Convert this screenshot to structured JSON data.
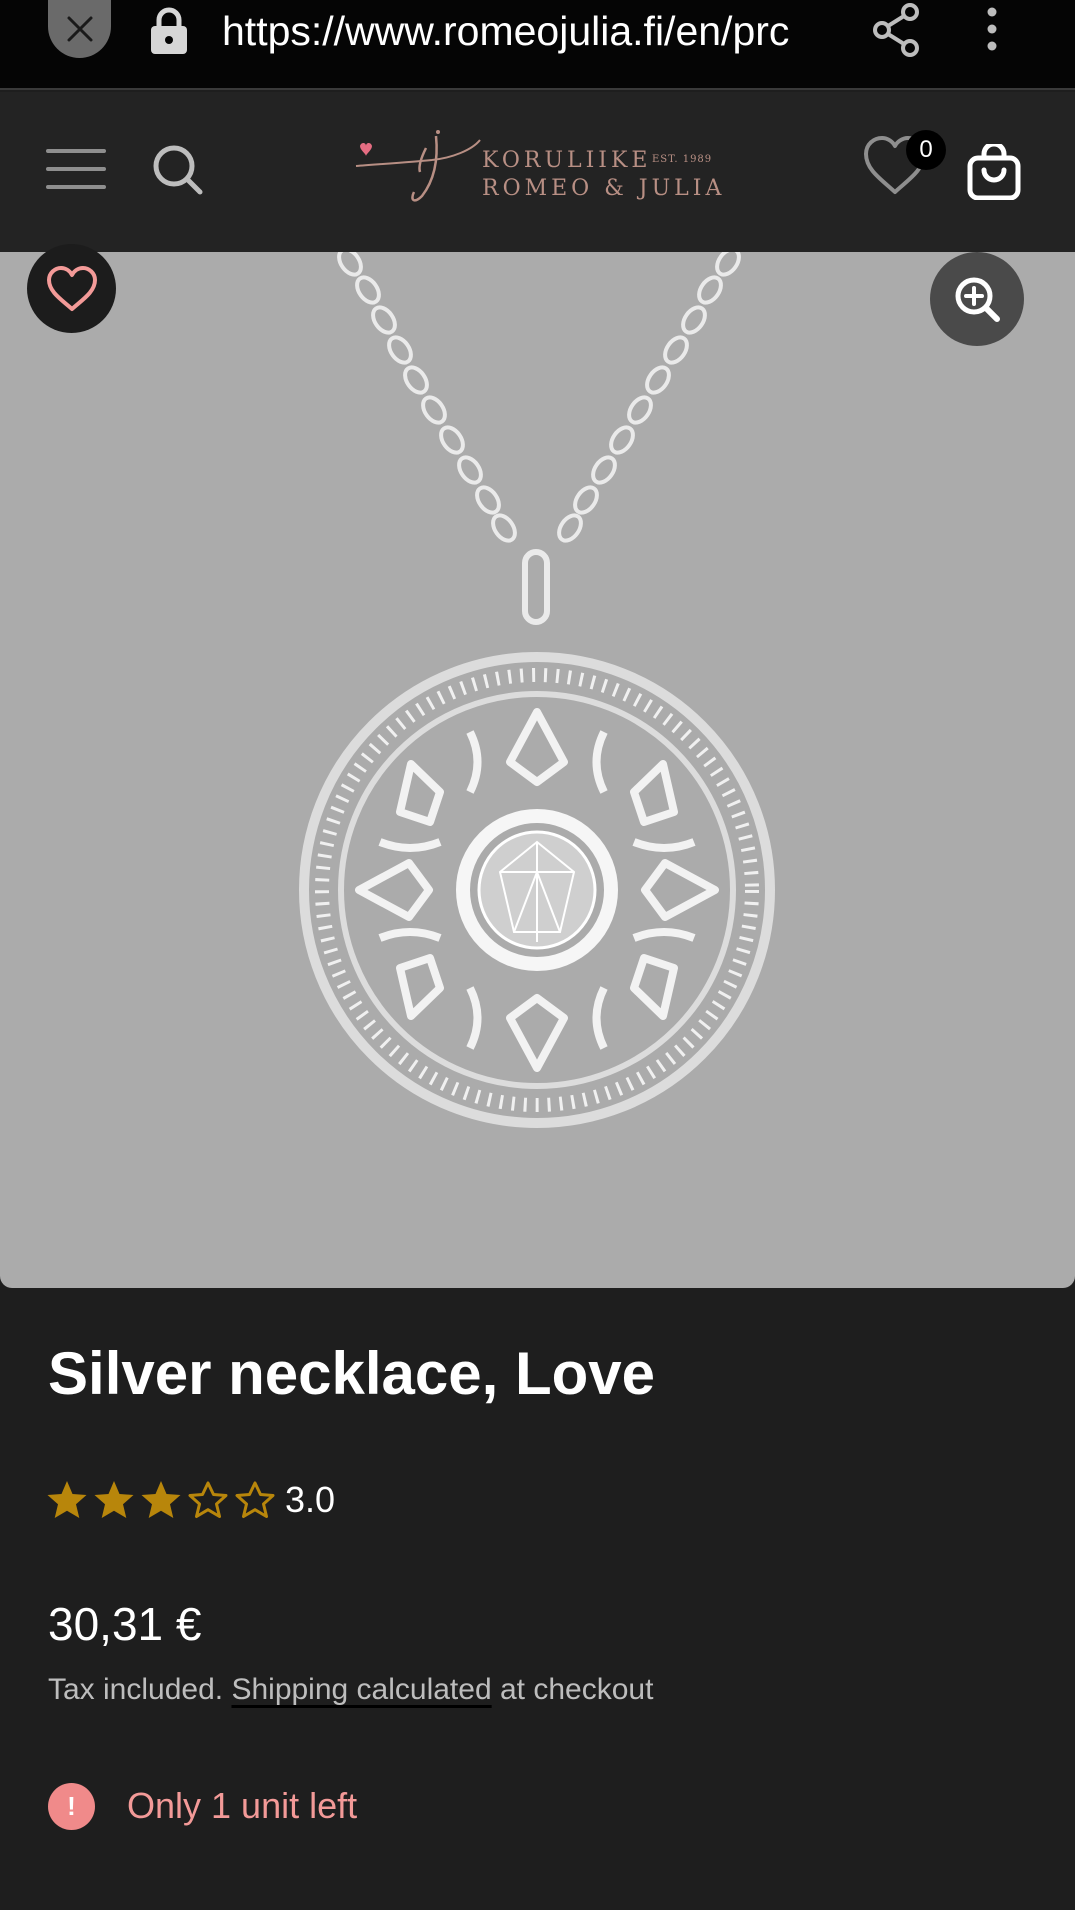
{
  "browser": {
    "url": "https://www.romeojulia.fi/en/prc",
    "icons": [
      "close-icon",
      "lock-icon",
      "share-icon",
      "more-vert-icon"
    ]
  },
  "header": {
    "logo": {
      "monogram": "rj",
      "line1": "KORULIIKE",
      "est": "EST. 1989",
      "line2": "ROMEO & JULIA"
    },
    "wishlist_count": "0",
    "icons": [
      "menu-icon",
      "search-icon",
      "heart-icon",
      "cart-icon"
    ]
  },
  "product": {
    "title": "Silver necklace, Love",
    "rating": {
      "value_text": "3.0",
      "value": 3,
      "max": 5
    },
    "price": "30,31 €",
    "tax_line": {
      "prefix": "Tax included.",
      "link": "Shipping calculated",
      "suffix": "at checkout"
    },
    "stock": {
      "icon": "!",
      "text": "Only 1 unit left"
    }
  },
  "colors": {
    "page_bg": "#1e1e1e",
    "header_bg": "#232323",
    "image_bg": "#ababab",
    "star": "#b8860b",
    "stock_alert": "#f39a98",
    "brand": "#b88f84"
  }
}
